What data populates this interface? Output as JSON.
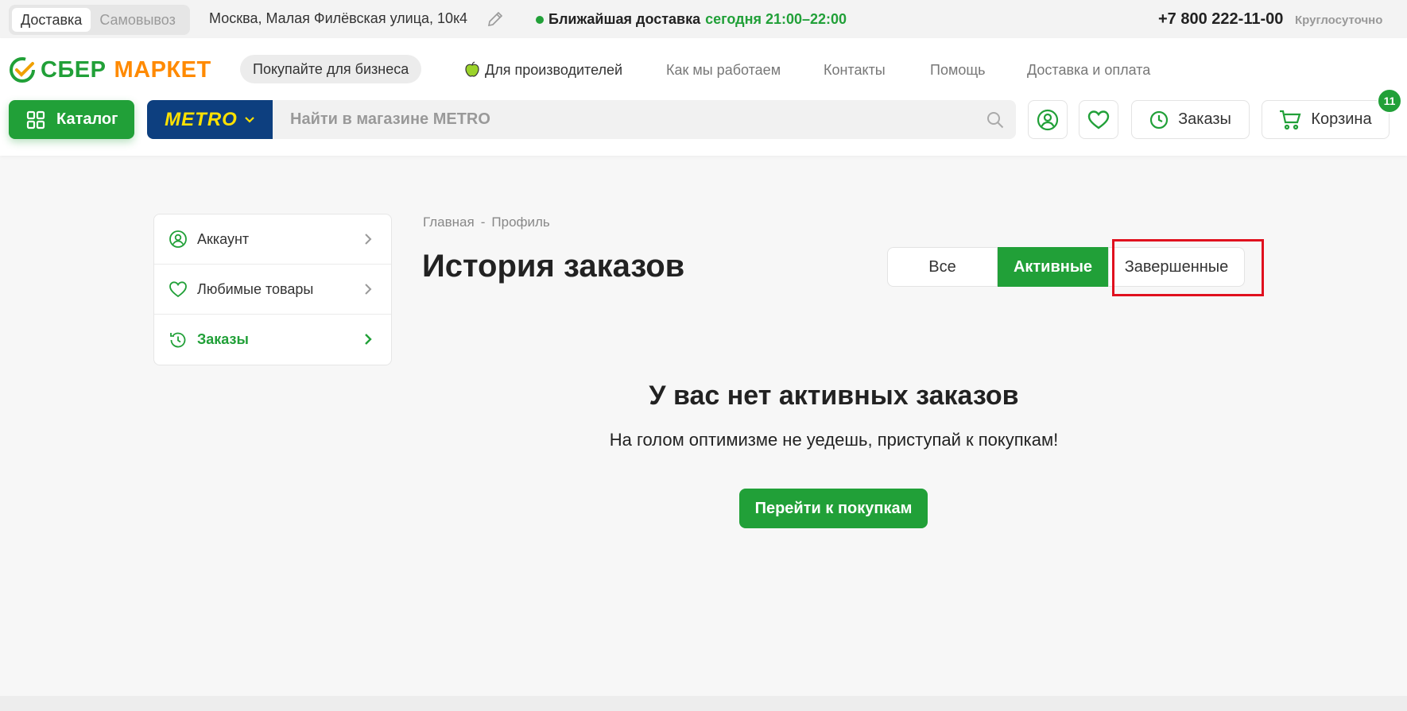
{
  "topbar": {
    "mode_delivery": "Доставка",
    "mode_pickup": "Самовывоз",
    "address": "Москва, Малая Филёвская улица, 10к4",
    "nearest_label": "Ближайшая доставка",
    "nearest_time": "сегодня 21:00–22:00",
    "phone": "+7 800 222-11-00",
    "hours": "Круглосуточно"
  },
  "header": {
    "logo_part1": "СБЕР",
    "logo_part2": "МАРКЕТ",
    "business_button": "Покупайте для бизнеса",
    "nav": [
      "Для производителей",
      "Как мы работаем",
      "Контакты",
      "Помощь",
      "Доставка и оплата"
    ],
    "catalog_label": "Каталог",
    "store_name": "METRO",
    "search_placeholder": "Найти в магазине METRO",
    "orders_label": "Заказы",
    "cart_label": "Корзина",
    "cart_count": "11"
  },
  "sidebar": {
    "items": [
      {
        "label": "Аккаунт"
      },
      {
        "label": "Любимые товары"
      },
      {
        "label": "Заказы"
      }
    ]
  },
  "main": {
    "breadcrumb": [
      "Главная",
      "Профиль"
    ],
    "breadcrumb_sep": "-",
    "title": "История заказов",
    "tabs": [
      "Все",
      "Активные",
      "Завершенные"
    ],
    "empty_title": "У вас нет активных заказов",
    "empty_subtitle": "На голом оптимизме не уедешь, приступай к покупкам!",
    "go_button": "Перейти к покупкам"
  },
  "colors": {
    "brand_green": "#21a038",
    "brand_orange": "#ff8a00",
    "metro_blue": "#0d3f7f",
    "metro_yellow": "#ffe100",
    "highlight_red": "#e0101e"
  }
}
